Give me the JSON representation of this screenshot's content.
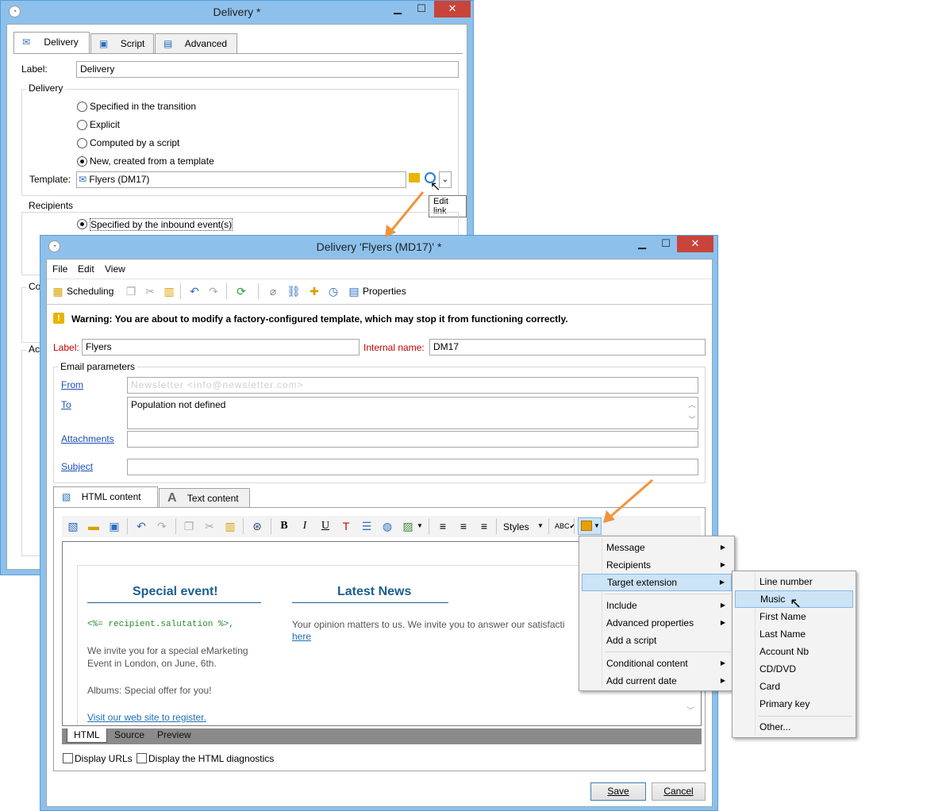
{
  "win1": {
    "title": "Delivery *",
    "tabs": [
      "Delivery",
      "Script",
      "Advanced"
    ],
    "label_caption": "Label:",
    "label_value": "Delivery",
    "delivery_group": "Delivery",
    "radios": [
      "Specified in the transition",
      "Explicit",
      "Computed by a script",
      "New, created from a template"
    ],
    "template_caption": "Template:",
    "template_value": "Flyers (DM17)",
    "tooltip": "Edit link",
    "recipients_group": "Recipients",
    "recipients_option": "Specified by the inbound event(s)",
    "cut_label_1": "Co",
    "cut_label_2": "Ac"
  },
  "win2": {
    "title": "Delivery 'Flyers (MD17)' *",
    "menu": [
      "File",
      "Edit",
      "View"
    ],
    "toolbar": {
      "scheduling": "Scheduling",
      "properties": "Properties"
    },
    "warning": "Warning: You are about to modify a factory-configured template, which may stop it from functioning correctly.",
    "label_caption": "Label:",
    "label_value": "Flyers",
    "internal_caption": "Internal name:",
    "internal_value": "DM17",
    "email_group": "Email parameters",
    "from_link": "From",
    "from_value": "Newsletter <info@newsletter.com>",
    "to_link": "To",
    "to_value": "Population not defined",
    "attachments_link": "Attachments",
    "subject_link": "Subject",
    "content_tabs": [
      "HTML content",
      "Text content"
    ],
    "styles_label": "Styles",
    "editor": {
      "heading_left": "Special event!",
      "heading_right": "Latest News",
      "salutation": "<%= recipient.salutation %>,",
      "invite_line1": "We invite you for a special eMarketing",
      "invite_line2": "Event in London, on June, 6th.",
      "albums": "Albums: Special offer for you!",
      "visit_link": "Visit our web site to register.",
      "opinion": "Your opinion matters to us. We invite you to answer our satisfacti",
      "here_link": "here"
    },
    "view_tabs": [
      "HTML",
      "Source",
      "Preview"
    ],
    "checkbox_urls": "Display URLs",
    "checkbox_diag": "Display the HTML diagnostics",
    "save_label": "Save",
    "cancel_label": "Cancel"
  },
  "context_menu": {
    "items": [
      "Message",
      "Recipients",
      "Target extension",
      "Include",
      "Advanced properties",
      "Add a script",
      "Conditional content",
      "Add current date"
    ]
  },
  "submenu": {
    "items": [
      "Line number",
      "Music",
      "First Name",
      "Last Name",
      "Account Nb",
      "CD/DVD",
      "Card",
      "Primary key",
      "Other..."
    ]
  },
  "colors": {
    "titlebar": "#8dc1ec",
    "close": "#c9443a",
    "arrow": "#f0933c",
    "heading": "#1b5f8f"
  }
}
